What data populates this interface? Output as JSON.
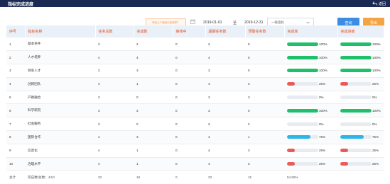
{
  "header": {
    "title": "指标完成进度",
    "back_label": "返回"
  },
  "toolbar": {
    "hint": "单位以个指标已完成率？",
    "date_from": "2019-01-01",
    "separator": "至",
    "date_to": "2019-12-31",
    "select_value": "一级指标",
    "query_label": "查询",
    "export_label": "导出"
  },
  "colors": {
    "green": "#20c06a",
    "red": "#ea5a5a",
    "blue": "#2bb6e8",
    "query": "#3c8de2",
    "export": "#f3a444"
  },
  "table": {
    "headers": [
      "序号",
      "指标名称",
      "任务总数",
      "完成数",
      "审核中",
      "超期任务数",
      "预警任务数",
      "完成率",
      "完成进度"
    ],
    "rows": [
      {
        "no": "1",
        "name": "基本条件",
        "total": "2",
        "done": "2",
        "review": "0",
        "overdue": "2",
        "warn": "0",
        "rate": 1.0,
        "rate_text": "100%",
        "rate_color": "green",
        "progress": 1.0,
        "progress_text": "100%",
        "progress_color": "green"
      },
      {
        "no": "2",
        "name": "人才培养",
        "total": "4",
        "done": "4",
        "review": "0",
        "overdue": "4",
        "warn": "0",
        "rate": 1.0,
        "rate_text": "100%",
        "rate_color": "green",
        "progress": 1.0,
        "progress_text": "100%",
        "progress_color": "green"
      },
      {
        "no": "3",
        "name": "领军人才",
        "total": "3",
        "done": "3",
        "review": "0",
        "overdue": "3",
        "warn": "0",
        "rate": 1.0,
        "rate_text": "100%",
        "rate_color": "green",
        "progress": 1.0,
        "progress_text": "100%",
        "progress_color": "green"
      },
      {
        "no": "4",
        "name": "创新团队",
        "total": "4",
        "done": "1",
        "review": "0",
        "overdue": "4",
        "warn": "3",
        "rate": 0.25,
        "rate_text": "25%",
        "rate_color": "red",
        "progress": 0.25,
        "progress_text": "25%",
        "progress_color": "red"
      },
      {
        "no": "5",
        "name": "产教融合",
        "total": "3",
        "done": "0",
        "review": "0",
        "overdue": "3",
        "warn": "3",
        "rate": 0.0,
        "rate_text": "0%",
        "rate_color": "green",
        "progress": 0.0,
        "progress_text": "0%",
        "progress_color": "green"
      },
      {
        "no": "6",
        "name": "科学研究",
        "total": "3",
        "done": "3",
        "review": "0",
        "overdue": "3",
        "warn": "0",
        "rate": 1.0,
        "rate_text": "100%",
        "rate_color": "green",
        "progress": 1.0,
        "progress_text": "100%",
        "progress_color": "green"
      },
      {
        "no": "7",
        "name": "社会服务",
        "total": "2",
        "done": "0",
        "review": "0",
        "overdue": "2",
        "warn": "2",
        "rate": 0.0,
        "rate_text": "0%",
        "rate_color": "green",
        "progress": 0.0,
        "progress_text": "0%",
        "progress_color": "green"
      },
      {
        "no": "8",
        "name": "国际合作",
        "total": "4",
        "done": "3",
        "review": "0",
        "overdue": "4",
        "warn": "1",
        "rate": 0.75,
        "rate_text": "75%",
        "rate_color": "blue",
        "progress": 0.75,
        "progress_text": "75%",
        "progress_color": "blue"
      },
      {
        "no": "9",
        "name": "信息化",
        "total": "4",
        "done": "1",
        "review": "0",
        "overdue": "4",
        "warn": "3",
        "rate": 0.25,
        "rate_text": "25%",
        "rate_color": "red",
        "progress": 0.25,
        "progress_text": "25%",
        "progress_color": "red"
      },
      {
        "no": "10",
        "name": "治理水平",
        "total": "4",
        "done": "1",
        "review": "0",
        "overdue": "4",
        "warn": "3",
        "rate": 0.25,
        "rate_text": "25%",
        "rate_color": "red",
        "progress": 0.25,
        "progress_text": "25%",
        "progress_color": "red"
      }
    ],
    "footer": {
      "label": "总计",
      "summary": "完成数/总数：4/10",
      "total": "33",
      "done": "18",
      "review": "0",
      "overdue": "33",
      "warn": "15",
      "rate_text": "54.55%"
    }
  }
}
